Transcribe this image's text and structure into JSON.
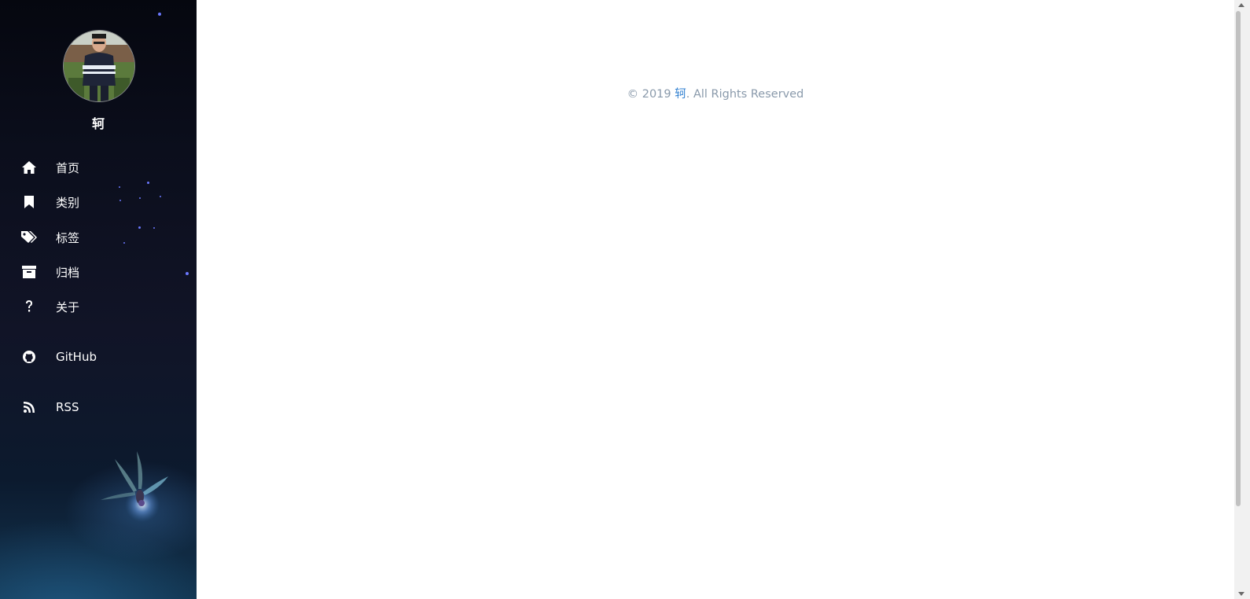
{
  "sidebar": {
    "author_name": "轲",
    "nav": [
      {
        "label": "首页",
        "icon": "home-icon"
      },
      {
        "label": "类别",
        "icon": "bookmark-icon"
      },
      {
        "label": "标签",
        "icon": "tags-icon"
      },
      {
        "label": "归档",
        "icon": "archive-icon"
      },
      {
        "label": "关于",
        "icon": "question-icon"
      },
      {
        "label": "GitHub",
        "icon": "github-icon"
      },
      {
        "label": "RSS",
        "icon": "rss-icon"
      }
    ]
  },
  "footer": {
    "prefix": "© 2019 ",
    "author_link": "轲",
    "suffix": ". All Rights Reserved"
  },
  "colors": {
    "link": "#2f7fd0",
    "footer_text": "#8a9aab",
    "nav_text": "#ffffff"
  }
}
